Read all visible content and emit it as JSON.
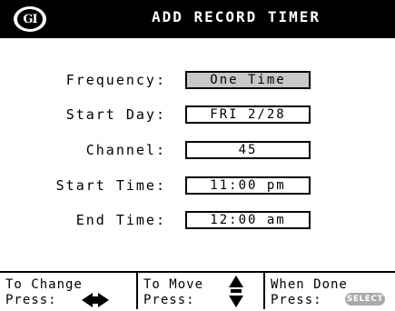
{
  "header": {
    "logo_text": "GI",
    "title": "ADD RECORD TIMER"
  },
  "form": {
    "rows": [
      {
        "label": "Frequency:",
        "value": "One Time",
        "selected": true
      },
      {
        "label": "Start Day:",
        "value": "FRI 2/28",
        "selected": false
      },
      {
        "label": "Channel:",
        "value": "45",
        "selected": false
      },
      {
        "label": "Start Time:",
        "value": "11:00 pm",
        "selected": false
      },
      {
        "label": "End Time:",
        "value": "12:00 am",
        "selected": false
      }
    ]
  },
  "footer": {
    "change": {
      "line1": "To Change",
      "line2": "Press:",
      "icon": "left-right-arrows-icon"
    },
    "move": {
      "line1": "To Move",
      "line2": "Press:",
      "icon": "up-down-arrows-icon"
    },
    "done": {
      "line1": "When Done",
      "line2": "Press:",
      "key_label": "SELECT"
    }
  },
  "colors": {
    "background": "#ffffff",
    "titlebar": "#000000",
    "selected_field": "#c8c8c8",
    "select_key": "#aaaaaa"
  }
}
